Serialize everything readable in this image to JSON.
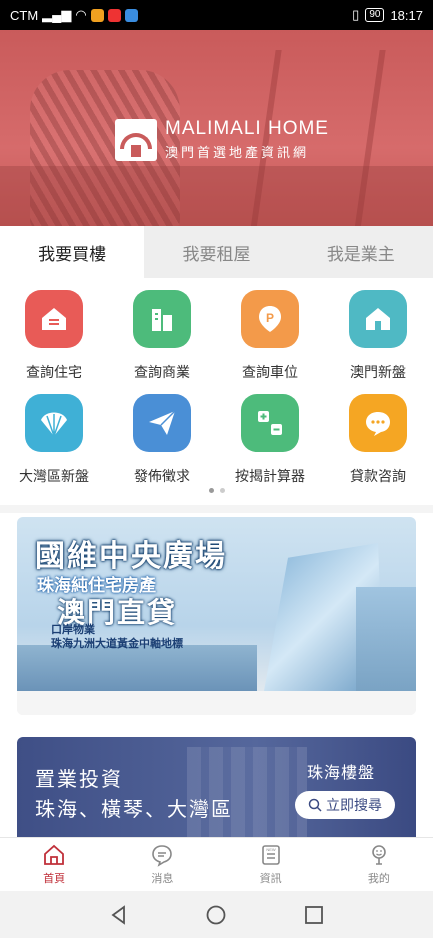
{
  "status_bar": {
    "carrier": "CTM",
    "battery": "90",
    "time": "18:17"
  },
  "brand": {
    "name_en": "MALIMALI HOME",
    "name_zh": "澳門首選地產資訊網"
  },
  "tabs": [
    {
      "label": "我要買樓",
      "active": true
    },
    {
      "label": "我要租屋",
      "active": false
    },
    {
      "label": "我是業主",
      "active": false
    }
  ],
  "shortcuts": [
    {
      "label": "查詢住宅",
      "icon": "home-icon",
      "color": "#e85b57"
    },
    {
      "label": "查詢商業",
      "icon": "building-icon",
      "color": "#4dbb7b"
    },
    {
      "label": "查詢車位",
      "icon": "parking-icon",
      "color": "#f39a4a"
    },
    {
      "label": "澳門新盤",
      "icon": "new-home-icon",
      "color": "#4fb9c4"
    },
    {
      "label": "大灣區新盤",
      "icon": "shell-icon",
      "color": "#3fb0d6"
    },
    {
      "label": "發佈徵求",
      "icon": "paper-plane-icon",
      "color": "#4a8fd6"
    },
    {
      "label": "按揭計算器",
      "icon": "calculator-icon",
      "color": "#4dbb7b"
    },
    {
      "label": "貸款咨詢",
      "icon": "chat-icon",
      "color": "#f5a623"
    }
  ],
  "banner1": {
    "title": "國維中央廣場",
    "sub1": "珠海純住宅房產",
    "sub2": "澳門直貸",
    "sub3": "口岸物業",
    "sub4": "珠海九洲大道黃金中軸地標"
  },
  "banner2": {
    "line1": "置業投資",
    "line2": "珠海、橫琴、大灣區",
    "tag": "珠海樓盤",
    "button": "立即搜尋"
  },
  "nav": [
    {
      "label": "首頁",
      "icon": "home-icon",
      "active": true
    },
    {
      "label": "消息",
      "icon": "message-icon",
      "active": false
    },
    {
      "label": "資訊",
      "icon": "news-icon",
      "active": false
    },
    {
      "label": "我的",
      "icon": "profile-icon",
      "active": false
    }
  ]
}
